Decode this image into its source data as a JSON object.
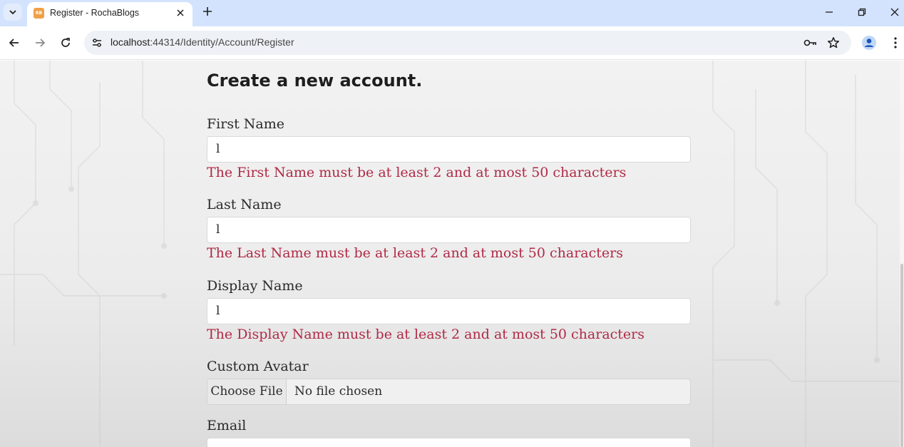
{
  "browser": {
    "tab_title": "Register - RochaBlogs",
    "favicon_text": "RB",
    "url_host": "localhost",
    "url_path": ":44314/Identity/Account/Register"
  },
  "page": {
    "heading": "Create a new account.",
    "fields": {
      "first_name": {
        "label": "First Name",
        "value": "l",
        "error": "The First Name must be at least 2 and at most 50 characters"
      },
      "last_name": {
        "label": "Last Name",
        "value": "l",
        "error": "The Last Name must be at least 2 and at most 50 characters"
      },
      "display_name": {
        "label": "Display Name",
        "value": "l",
        "error": "The Display Name must be at least 2 and at most 50 characters"
      },
      "custom_avatar": {
        "label": "Custom Avatar",
        "button": "Choose File",
        "status": "No file chosen"
      },
      "email": {
        "label": "Email"
      }
    }
  },
  "colors": {
    "error": "#b02a46",
    "tabstrip": "#d3e3fd"
  }
}
